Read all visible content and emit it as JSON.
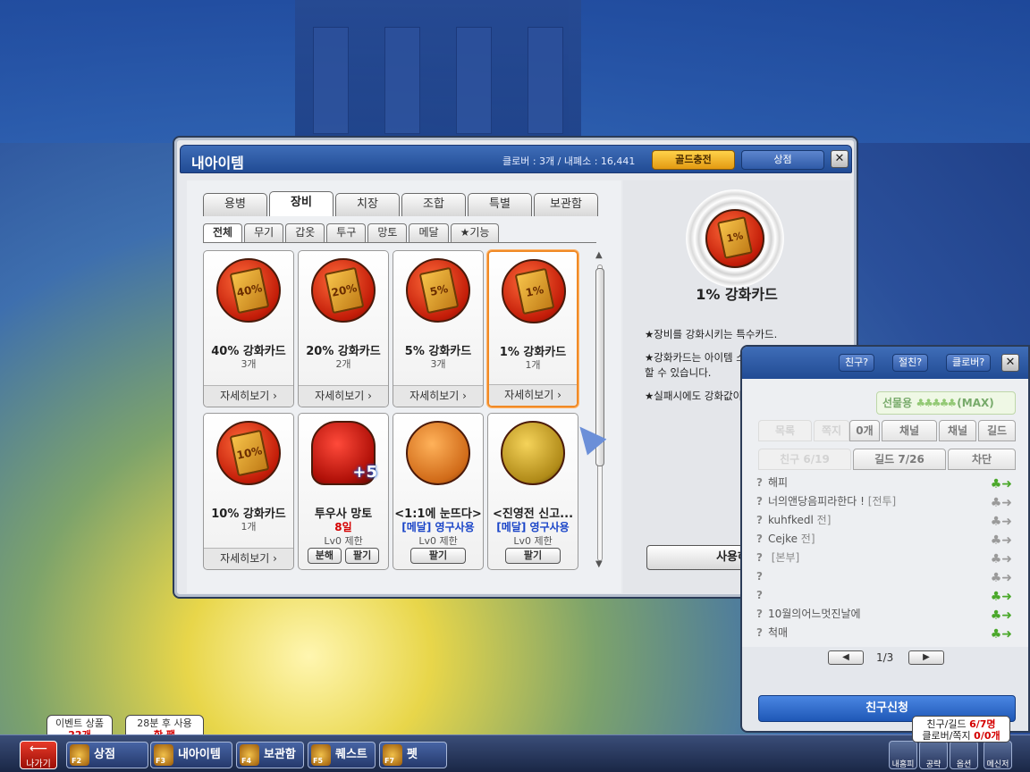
{
  "window": {
    "title": "내아이템",
    "meta": "클로버 : 3개  /  내폐소 : 16,441",
    "gold_btn": "골드충전",
    "shop_btn": "상점",
    "close": "✕"
  },
  "tabs1": [
    "용병",
    "장비",
    "치장",
    "조합",
    "특별",
    "보관함"
  ],
  "tabs2": [
    "전체",
    "무기",
    "갑옷",
    "투구",
    "망토",
    "메달",
    "★기능"
  ],
  "items": [
    {
      "name": "40% 강화카드",
      "sub": "3개",
      "badge": "40%",
      "detail": "자세히보기 ›"
    },
    {
      "name": "20% 강화카드",
      "sub": "2개",
      "badge": "20%",
      "detail": "자세히보기 ›"
    },
    {
      "name": "5% 강화카드",
      "sub": "3개",
      "badge": "5%",
      "detail": "자세히보기 ›"
    },
    {
      "name": "1% 강화카드",
      "sub": "1개",
      "badge": "1%",
      "detail": "자세히보기 ›"
    },
    {
      "name": "10% 강화카드",
      "sub": "1개",
      "badge": "10%",
      "detail": "자세히보기 ›"
    },
    {
      "name": "투우사 망토",
      "sub": "8일",
      "sub2": "Lv0 제한",
      "btn1": "분해",
      "btn2": "팔기"
    },
    {
      "name": "<1:1에 눈뜨다>",
      "sub": "[메달] 영구사용",
      "sub2": "Lv0 제한",
      "btn1": "팔기"
    },
    {
      "name": "<진영전 신고...",
      "sub": "[메달] 영구사용",
      "sub2": "Lv0 제한",
      "btn1": "팔기"
    }
  ],
  "preview": {
    "badge": "1%",
    "name": "1% 강화카드",
    "desc": [
      "★장비를 강화시키는 특수카드.",
      "★강화카드는 아이템 소모 없이 강화를 시도할 수 있습니다.",
      "★실패시에도 강화값이 하락하지 않음"
    ],
    "use_btn": "사용하기"
  },
  "friends": {
    "top_btns": [
      "친구?",
      "절친?",
      "클로버?"
    ],
    "gift_label": "선물용",
    "gift_max": "(MAX)",
    "tabs_row1": [
      "목록",
      "쪽지",
      "0개",
      "채널",
      "채널",
      "길드"
    ],
    "tabs_row2": [
      "친구 6/19",
      "길드 7/26",
      "차단"
    ],
    "rows": [
      {
        "name": "해피",
        "heart": "green"
      },
      {
        "name": "너의앤당음피라한다 !",
        "tag": "[전투]",
        "heart": "gray"
      },
      {
        "name": "kuhfkedl",
        "tag": "전]",
        "heart": "gray"
      },
      {
        "name": "Cejke",
        "tag": "전]",
        "heart": "gray"
      },
      {
        "name": "",
        "tag": "[본부]",
        "heart": "gray"
      },
      {
        "name": "",
        "heart": "gray"
      },
      {
        "name": "",
        "heart": "green"
      },
      {
        "name": "10월의어느멋진날에",
        "heart": "green"
      },
      {
        "name": "척매",
        "heart": "green"
      }
    ],
    "page": "1/3",
    "add_btn": "친구신청"
  },
  "taskbar": {
    "exit": "나가기",
    "buttons": [
      {
        "key": "F2",
        "label": "상점"
      },
      {
        "key": "F3",
        "label": "내아이템"
      },
      {
        "key": "F4",
        "label": "보관함"
      },
      {
        "key": "F5",
        "label": "퀘스트"
      },
      {
        "key": "F7",
        "label": "펫"
      }
    ],
    "tip1_line1": "이벤트 상품",
    "tip1_line2": "22개",
    "tip2_line1": "28분 후 사용",
    "tip2_line2": "핫 팩",
    "right": [
      "내홈피",
      "공략",
      "옵션",
      "메신저"
    ],
    "status_line1_a": "친구/길드 ",
    "status_line1_b": "6/7명",
    "status_line2_a": "클로버/쪽지 ",
    "status_line2_b": "0/0개"
  }
}
